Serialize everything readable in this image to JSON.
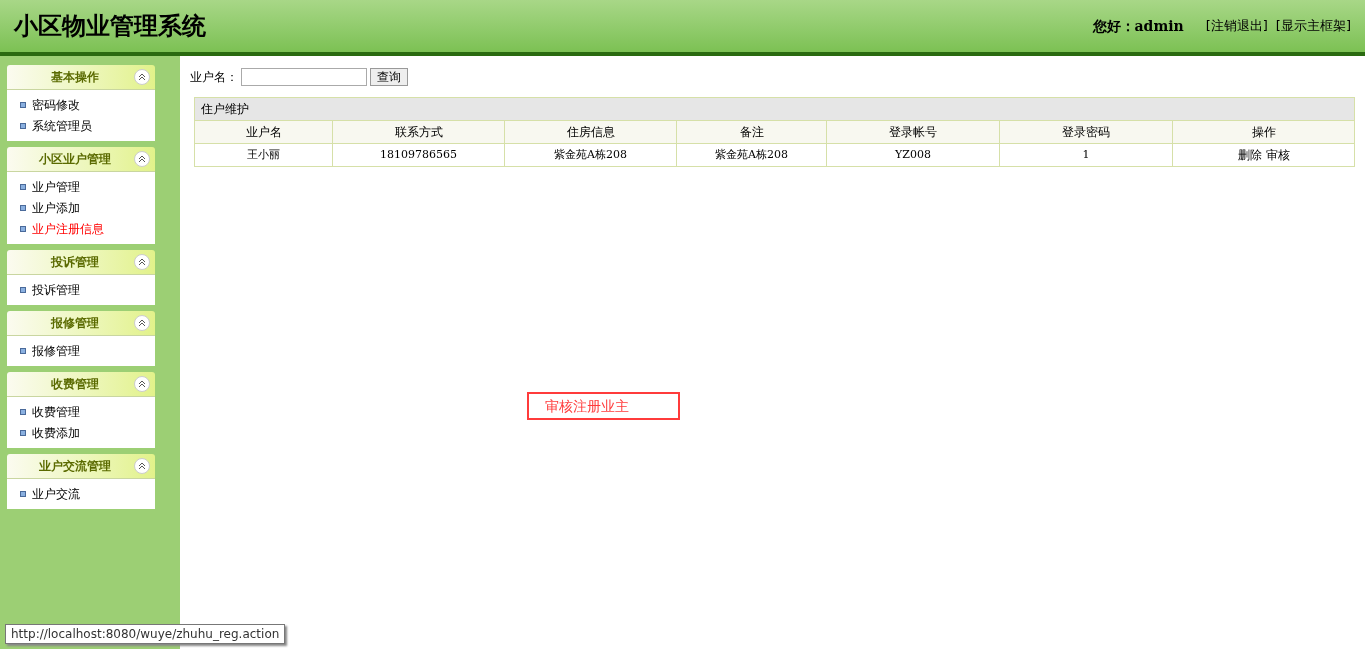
{
  "header": {
    "title": "小区物业管理系统",
    "greeting": "您好：",
    "user": "admin",
    "links": [
      "[注销退出]",
      "[显示主框架]"
    ]
  },
  "sidebar": [
    {
      "title": "基本操作",
      "items": [
        {
          "label": "密码修改",
          "selected": false
        },
        {
          "label": "系统管理员",
          "selected": false
        }
      ]
    },
    {
      "title": "小区业户管理",
      "items": [
        {
          "label": "业户管理",
          "selected": false
        },
        {
          "label": "业户添加",
          "selected": false
        },
        {
          "label": "业户注册信息",
          "selected": true
        }
      ]
    },
    {
      "title": "投诉管理",
      "items": [
        {
          "label": "投诉管理",
          "selected": false
        }
      ]
    },
    {
      "title": "报修管理",
      "items": [
        {
          "label": "报修管理",
          "selected": false
        }
      ]
    },
    {
      "title": "收费管理",
      "items": [
        {
          "label": "收费管理",
          "selected": false
        },
        {
          "label": "收费添加",
          "selected": false
        }
      ]
    },
    {
      "title": "业户交流管理",
      "items": [
        {
          "label": "业户交流",
          "selected": false
        }
      ]
    }
  ],
  "search": {
    "label": "业户名：",
    "button": "查询"
  },
  "table": {
    "caption": "住户维护",
    "columns": [
      "业户名",
      "联系方式",
      "住房信息",
      "备注",
      "登录帐号",
      "登录密码",
      "操作"
    ],
    "rows": [
      {
        "cells": [
          "王小丽",
          "18109786565",
          "紫金苑A栋208",
          "紫金苑A栋208",
          "YZ008",
          "1"
        ],
        "actions": [
          "删除",
          "审核"
        ]
      }
    ]
  },
  "annotation": "审核注册业主",
  "status_url": "http://localhost:8080/wuye/zhuhu_reg.action"
}
